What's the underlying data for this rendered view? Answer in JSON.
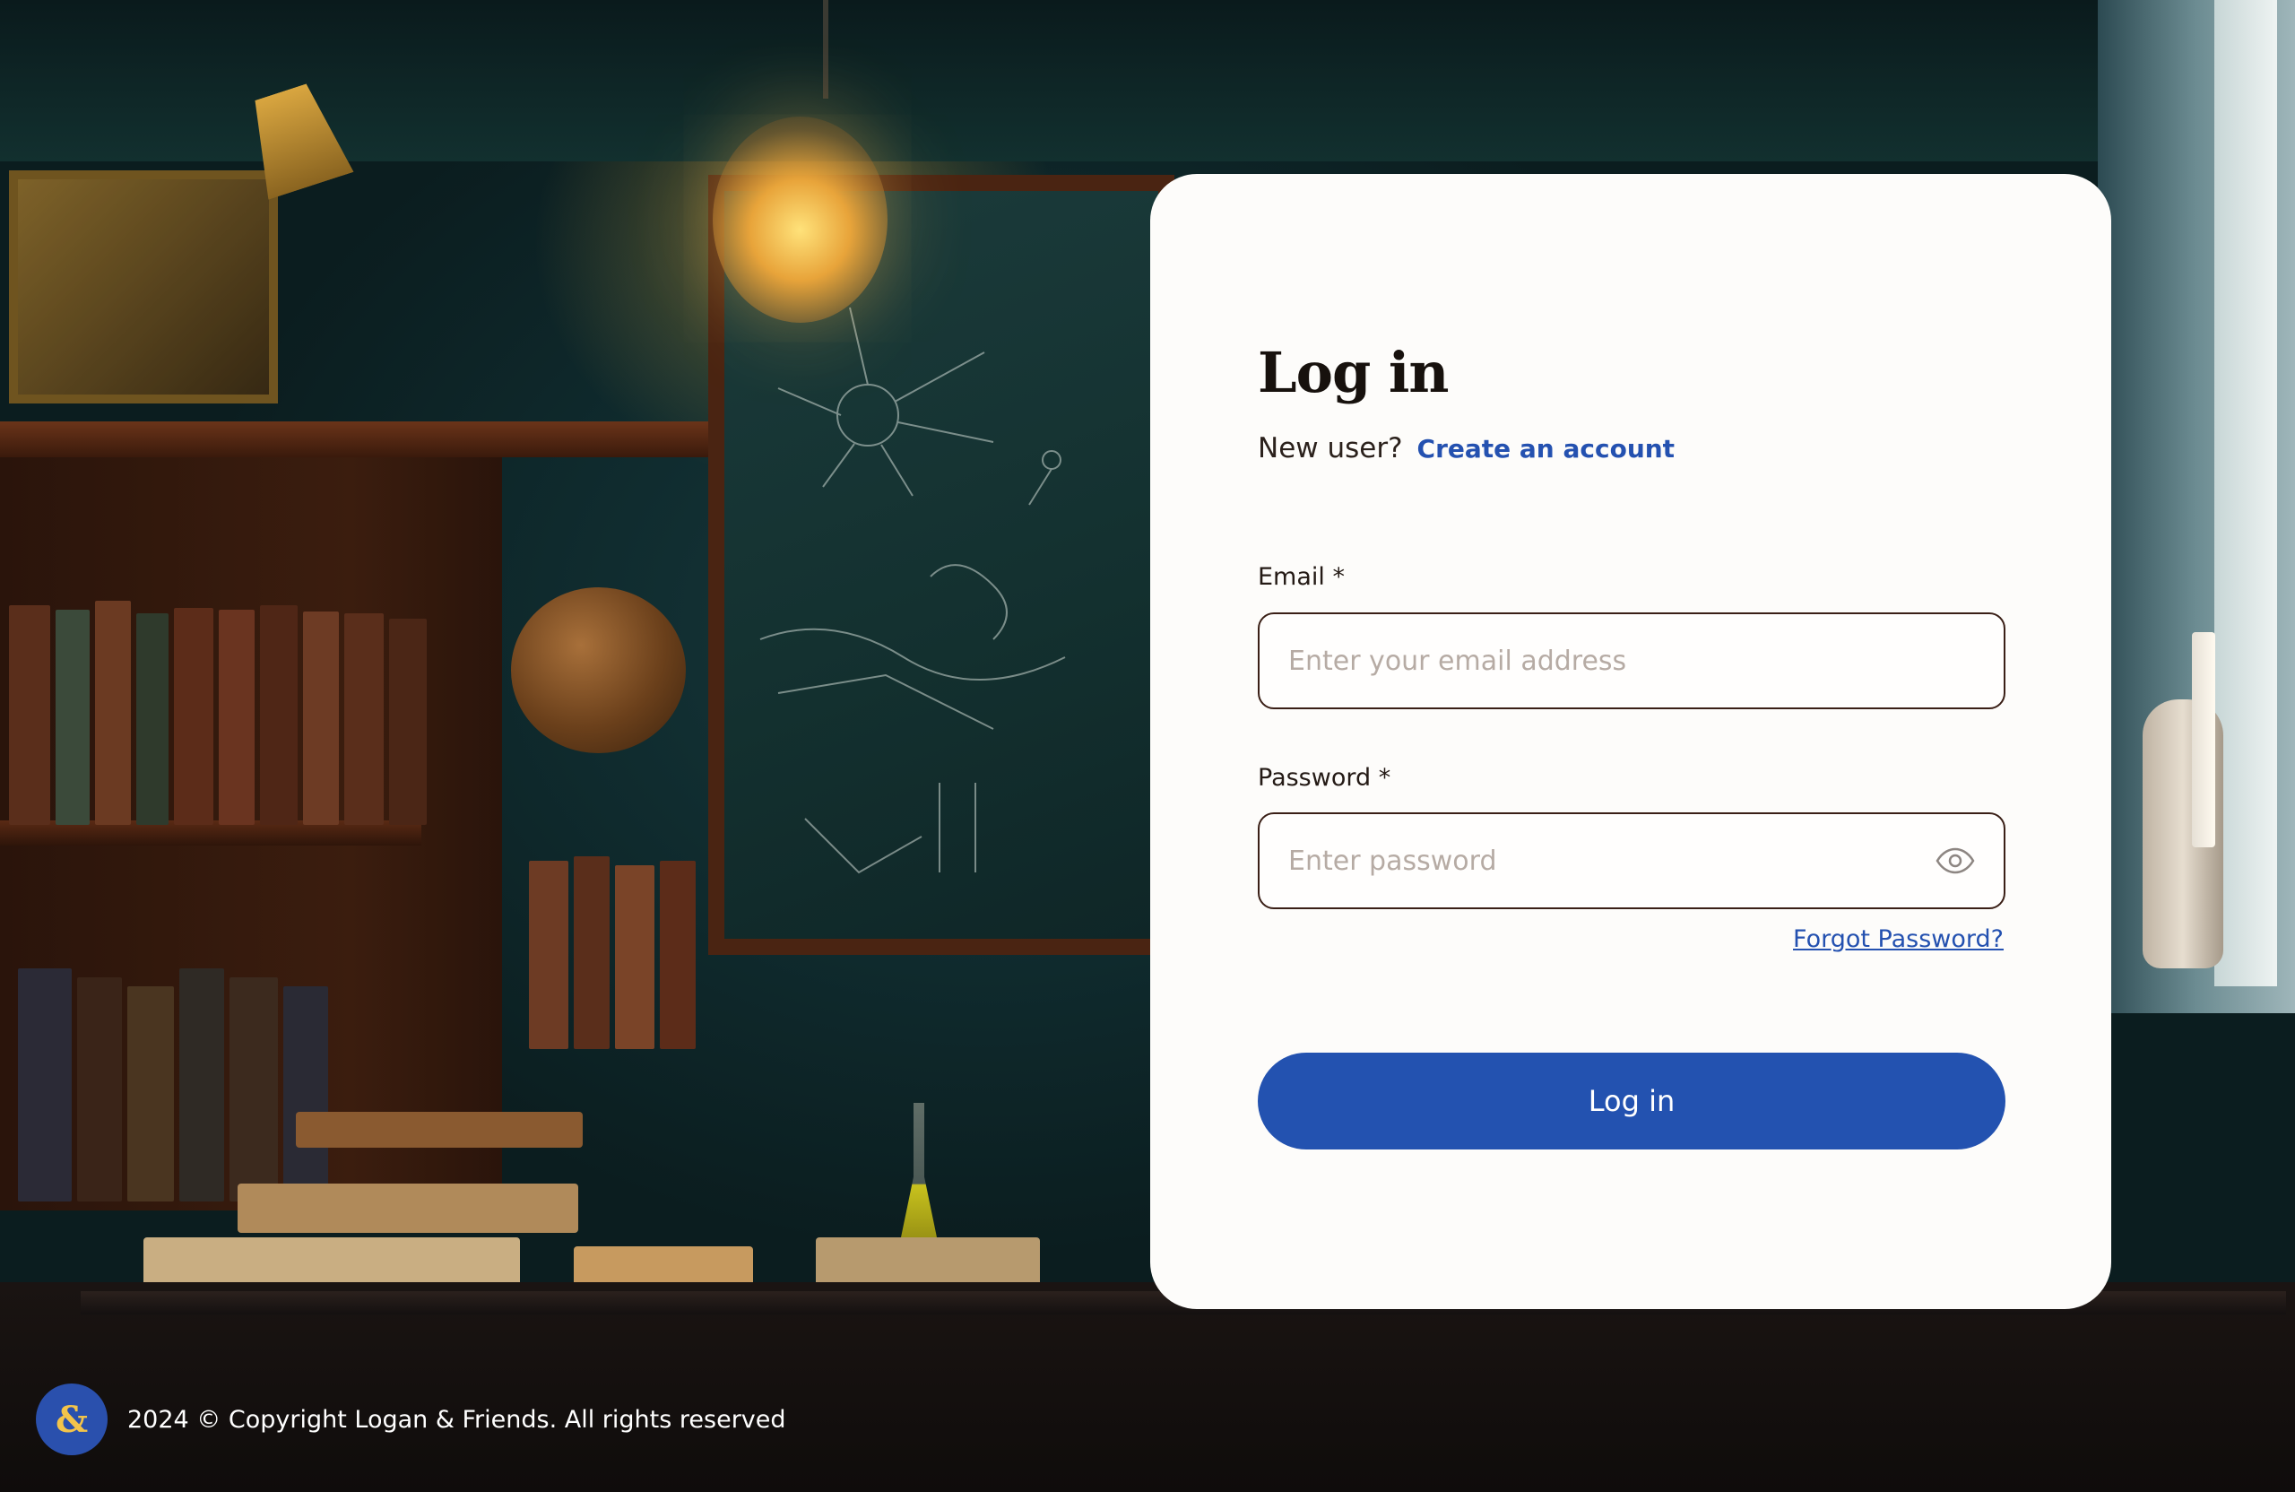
{
  "login": {
    "title": "Log in",
    "new_user_text": "New user?",
    "create_account_link": "Create an account",
    "email_label": "Email *",
    "email_placeholder": "Enter your email address",
    "email_value": "",
    "password_label": "Password *",
    "password_placeholder": "Enter password",
    "password_value": "",
    "password_toggle_icon": "eye-icon",
    "forgot_password_link": "Forgot Password?",
    "submit_label": "Log in"
  },
  "footer": {
    "logo_glyph": "&",
    "copyright": "2024 © Copyright Logan & Friends. All rights reserved"
  },
  "colors": {
    "card_background": "#fdfcfa",
    "accent_blue": "#2352b0",
    "title_text": "#17110d",
    "input_border": "#3a1f16",
    "placeholder": "#b6aba4",
    "logo_glyph": "#f3c44a"
  }
}
